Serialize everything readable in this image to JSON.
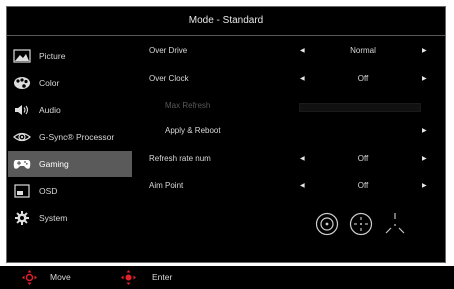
{
  "title": "Mode - Standard",
  "sidebar": {
    "items": [
      {
        "label": "Picture",
        "icon": "picture-icon"
      },
      {
        "label": "Color",
        "icon": "palette-icon"
      },
      {
        "label": "Audio",
        "icon": "speaker-icon"
      },
      {
        "label": "G-Sync® Processor",
        "icon": "gsync-eye-icon"
      },
      {
        "label": "Gaming",
        "icon": "gamepad-icon",
        "selected": true
      },
      {
        "label": "OSD",
        "icon": "osd-window-icon"
      },
      {
        "label": "System",
        "icon": "gear-icon"
      }
    ]
  },
  "settings": {
    "over_drive": {
      "label": "Over Drive",
      "value": "Normal"
    },
    "over_clock": {
      "label": "Over Clock",
      "value": "Off"
    },
    "max_refresh": {
      "label": "Max Refresh"
    },
    "apply_reboot": {
      "label": "Apply & Reboot"
    },
    "refresh_rate_num": {
      "label": "Refresh rate num",
      "value": "Off"
    },
    "aim_point": {
      "label": "Aim Point",
      "value": "Off"
    }
  },
  "aim_options": [
    "aim-circle-dot-icon",
    "aim-dashed-circle-icon",
    "aim-tri-line-icon"
  ],
  "footer": {
    "move_label": "Move",
    "enter_label": "Enter"
  },
  "colors": {
    "selected_bg": "#5a5a5a",
    "dpad_red": "#e8202a",
    "dim_text": "#595959"
  }
}
